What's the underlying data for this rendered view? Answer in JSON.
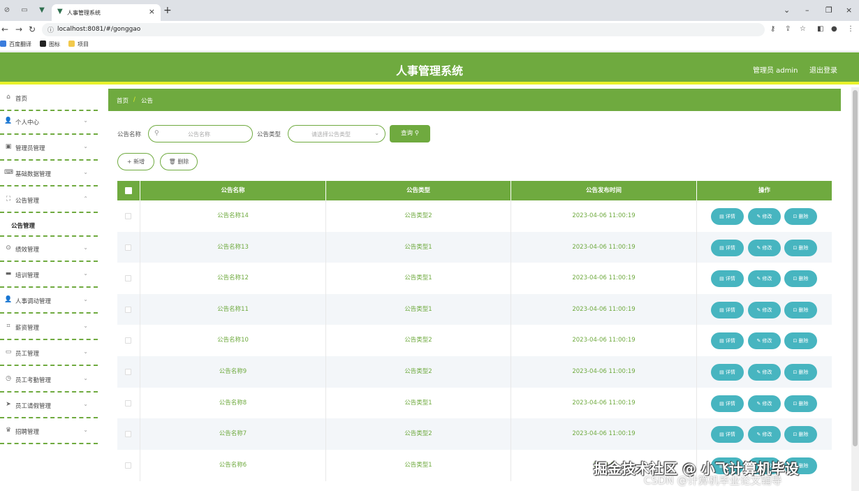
{
  "browser": {
    "active_tab_title": "人事管理系统",
    "url": "localhost:8081/#/gonggao",
    "bookmarks": [
      "百度翻译",
      "图标",
      "项目"
    ]
  },
  "header": {
    "title": "人事管理系统",
    "user": "管理员 admin",
    "logout": "退出登录"
  },
  "sidebar": {
    "items": [
      {
        "label": "首页",
        "icon": "home-icon"
      },
      {
        "label": "个人中心",
        "icon": "user-icon"
      },
      {
        "label": "管理员管理",
        "icon": "clipboard-icon"
      },
      {
        "label": "基础数据管理",
        "icon": "keyboard-icon"
      },
      {
        "label": "公告管理",
        "icon": "frame-icon"
      },
      {
        "label": "绩效管理",
        "icon": "compass-icon"
      },
      {
        "label": "培训管理",
        "icon": "monitor-icon"
      },
      {
        "label": "人事调动管理",
        "icon": "user-icon"
      },
      {
        "label": "薪资管理",
        "icon": "crop-icon"
      },
      {
        "label": "员工管理",
        "icon": "ticket-icon"
      },
      {
        "label": "员工考勤管理",
        "icon": "clock-icon"
      },
      {
        "label": "员工请假管理",
        "icon": "send-icon"
      },
      {
        "label": "招聘管理",
        "icon": "trophy-icon"
      }
    ],
    "active_sub": "公告管理"
  },
  "breadcrumb": {
    "home": "首页",
    "sep": "/",
    "current": "公告"
  },
  "search": {
    "name_label": "公告名称",
    "name_placeholder": "公告名称",
    "type_label": "公告类型",
    "type_placeholder": "请选择公告类型",
    "query": "查询"
  },
  "actions": {
    "add": "新增",
    "delete": "删除"
  },
  "table": {
    "headers": [
      "公告名称",
      "公告类型",
      "公告发布时间",
      "操作"
    ],
    "row_buttons": [
      "详情",
      "修改",
      "删除"
    ],
    "rows": [
      {
        "name": "公告名称14",
        "type": "公告类型2",
        "time": "2023-04-06 11:00:19"
      },
      {
        "name": "公告名称13",
        "type": "公告类型1",
        "time": "2023-04-06 11:00:19"
      },
      {
        "name": "公告名称12",
        "type": "公告类型1",
        "time": "2023-04-06 11:00:19"
      },
      {
        "name": "公告名称11",
        "type": "公告类型1",
        "time": "2023-04-06 11:00:19"
      },
      {
        "name": "公告名称10",
        "type": "公告类型2",
        "time": "2023-04-06 11:00:19"
      },
      {
        "name": "公告名称9",
        "type": "公告类型2",
        "time": "2023-04-06 11:00:19"
      },
      {
        "name": "公告名称8",
        "type": "公告类型1",
        "time": "2023-04-06 11:00:19"
      },
      {
        "name": "公告名称7",
        "type": "公告类型2",
        "time": "2023-04-06 11:00:19"
      },
      {
        "name": "公告名称6",
        "type": "公告类型1",
        "time": "2023-0"
      }
    ]
  },
  "watermark": {
    "line1": "掘金技术社区 @ 小飞计算机毕设",
    "line2": "CSDN @计算机毕业论文辅导"
  },
  "colors": {
    "primary": "#6faa3f",
    "accent": "#e8f12a",
    "button": "#47b5c0"
  }
}
